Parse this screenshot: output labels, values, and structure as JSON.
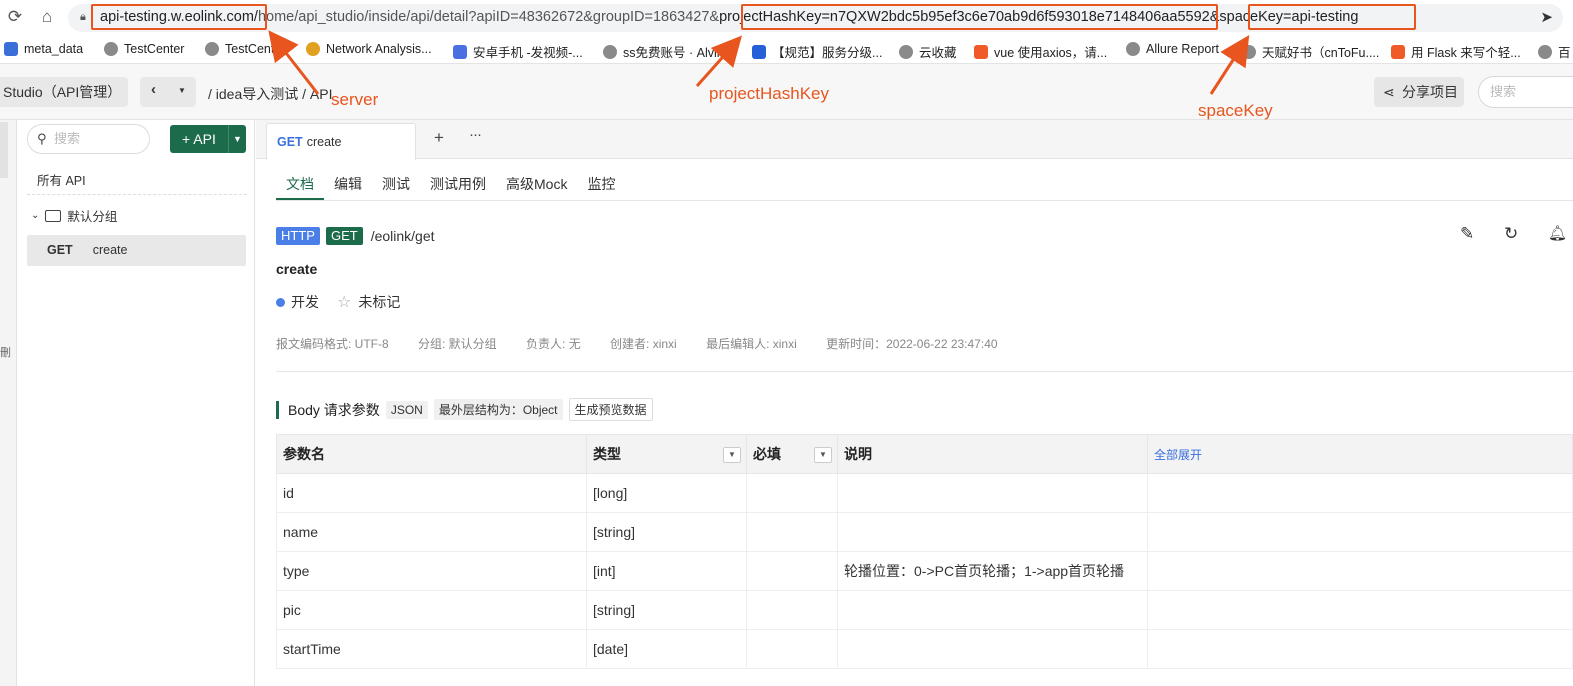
{
  "browser": {
    "url_server": "api-testing.w.eolink.com/",
    "url_path": "home/api_studio/inside/api/detail?apiID=48362672&groupID=1863427&",
    "url_project": "projectHashKey=n7QXW2bdc5b95ef3c6e70ab9d6f593018e7148406aa5592",
    "url_space": "&spaceKey=api-testing"
  },
  "bookmarks": [
    {
      "label": "meta_data",
      "icon": "bookmark-b-icon"
    },
    {
      "label": "TestCenter",
      "icon": "globe-icon"
    },
    {
      "label": "TestCenter",
      "icon": "globe-icon"
    },
    {
      "label": "Network Analysis...",
      "icon": "chrome-icon"
    },
    {
      "label": "安卓手机 -发视频-...",
      "icon": "cloud-icon"
    },
    {
      "label": "ss免费账号 · Alvin",
      "icon": "globe-icon"
    },
    {
      "label": "【规范】服务分级...",
      "icon": "confluence-icon"
    },
    {
      "label": "云收藏",
      "icon": "globe-icon"
    },
    {
      "label": "vue 使用axios，请...",
      "icon": "csdn-icon"
    },
    {
      "label": "Allure Report",
      "icon": "globe-icon"
    },
    {
      "label": "天赋好书（cnToFu....",
      "icon": "globe-icon"
    },
    {
      "label": "用 Flask 来写个轻...",
      "icon": "csdn-icon"
    },
    {
      "label": "百",
      "icon": "globe-icon"
    }
  ],
  "header": {
    "studio": "Studio（API管理）",
    "breadcrumb": "/ idea导入测试 / API",
    "share": "分享项目",
    "search_placeholder": "搜索"
  },
  "sidebar": {
    "search_placeholder": "搜索",
    "add_api": "+ API",
    "all_api": "所有 API",
    "group": "默认分组",
    "item_method": "GET",
    "item_name": "create"
  },
  "tab": {
    "method": "GET",
    "name": "create"
  },
  "subtabs": [
    "文档",
    "编辑",
    "测试",
    "测试用例",
    "高级Mock",
    "监控"
  ],
  "api": {
    "protocol": "HTTP",
    "method": "GET",
    "path": "/eolink/get",
    "name": "create",
    "status": "开发",
    "mark": "未标记",
    "meta": [
      "报文编码格式: UTF-8",
      "分组: 默认分组",
      "负责人: 无",
      "创建者: xinxi",
      "最后编辑人: xinxi",
      "更新时间：2022-06-22 23:47:40"
    ]
  },
  "body": {
    "title": "Body 请求参数",
    "format": "JSON",
    "outer": "最外层结构为：Object",
    "preview": "生成预览数据"
  },
  "table": {
    "headers": [
      "参数名",
      "类型",
      "必填",
      "说明",
      "全部展开"
    ],
    "rows": [
      [
        "id",
        "[long]",
        "",
        ""
      ],
      [
        "name",
        "[string]",
        "",
        ""
      ],
      [
        "type",
        "[int]",
        "",
        "轮播位置：0->PC首页轮播；1->app首页轮播"
      ],
      [
        "pic",
        "[string]",
        "",
        ""
      ],
      [
        "startTime",
        "[date]",
        "",
        ""
      ]
    ]
  },
  "annotations": {
    "server": "server",
    "project": "projectHashKey",
    "space": "spaceKey",
    "color": "#e8551f"
  }
}
